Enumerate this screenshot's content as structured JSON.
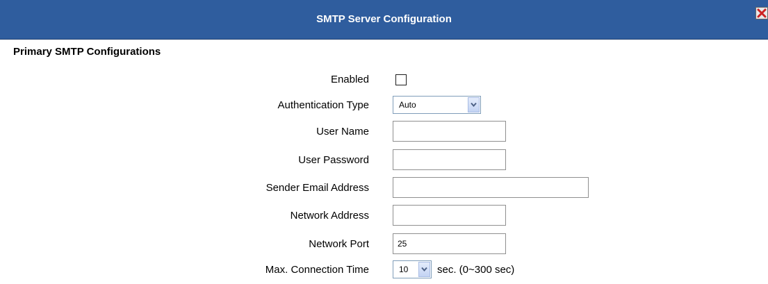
{
  "dialog": {
    "title": "SMTP Server Configuration",
    "close_icon": "close-x-icon"
  },
  "section": {
    "title": "Primary SMTP Configurations"
  },
  "fields": {
    "enabled": {
      "label": "Enabled",
      "checked": false
    },
    "auth_type": {
      "label": "Authentication Type",
      "value": "Auto"
    },
    "user_name": {
      "label": "User Name",
      "value": ""
    },
    "user_password": {
      "label": "User Password",
      "value": ""
    },
    "sender_email": {
      "label": "Sender Email Address",
      "value": ""
    },
    "network_address": {
      "label": "Network Address",
      "value": ""
    },
    "network_port": {
      "label": "Network Port",
      "value": "25"
    },
    "max_connection_time": {
      "label": "Max. Connection Time",
      "value": "10",
      "suffix": "sec. (0~300 sec)"
    }
  },
  "colors": {
    "titlebar": "#2f5d9e",
    "close_icon": "#cc2222"
  }
}
